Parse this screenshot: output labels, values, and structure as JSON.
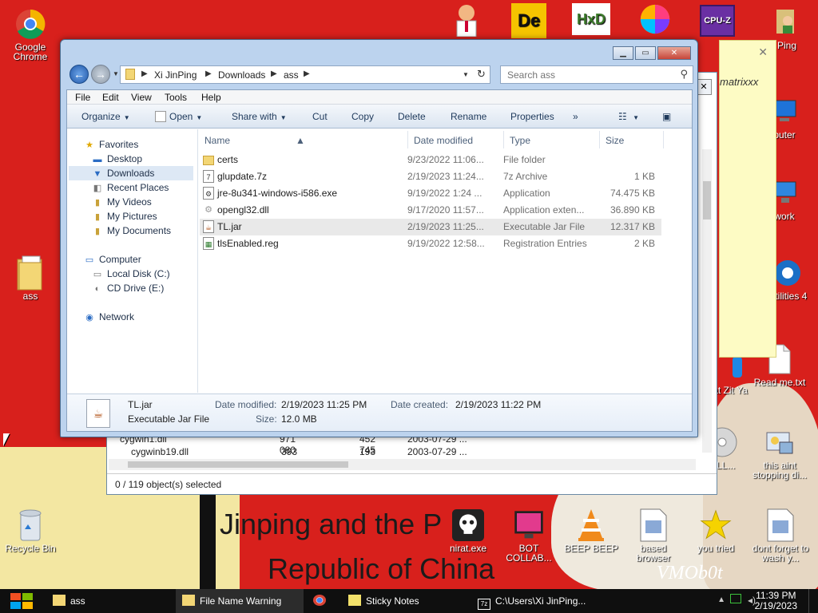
{
  "desktop": {
    "icons": [
      {
        "label": "Google Chrome",
        "icon": "chrome-icon"
      },
      {
        "label": "ass",
        "icon": "folder-icon"
      },
      {
        "label": "Recycle Bin",
        "icon": "recycle-bin-icon"
      },
      {
        "label": "puter",
        "icon": "computer-icon"
      },
      {
        "label": "work",
        "icon": "network-icon"
      },
      {
        "label": "Utilities 4",
        "icon": "utilities-icon"
      },
      {
        "label": "at Zit Ya",
        "icon": "app-icon"
      },
      {
        "label": "Read me.txt",
        "icon": "text-file-icon"
      },
      {
        "label": "this aint stopping di...",
        "icon": "installer-icon"
      },
      {
        "label": "OLL...",
        "icon": "disc-icon"
      },
      {
        "label": "nirat.exe",
        "icon": "skull-icon"
      },
      {
        "label": "BOT COLLAB...",
        "icon": "monitor-icon"
      },
      {
        "label": "BEEP BEEP",
        "icon": "vlc-icon"
      },
      {
        "label": "based browser",
        "icon": "file-icon"
      },
      {
        "label": "you tried",
        "icon": "star-icon"
      },
      {
        "label": "dont forget to wash y...",
        "icon": "file-icon"
      },
      {
        "label": "Ping",
        "icon": "user-icon"
      }
    ],
    "wallpaper_text_line1": "Jinping and the P",
    "wallpaper_text_line2": "Republic of China",
    "wallpaper_signature": "VMOb0t",
    "sticky_note_text": "matrixxx",
    "top_icons": [
      {
        "label": "De",
        "icon": "de-icon"
      },
      {
        "label": "HxD",
        "icon": "hxd-icon"
      },
      {
        "label": "CPU-Z",
        "icon": "cpuz-icon"
      }
    ]
  },
  "bg_window": {
    "rows": [
      {
        "name": "cygwin1.dll",
        "size1": "971 080",
        "size2": "452 745",
        "date": "2003-07-29 ..."
      },
      {
        "name": "cygwinb19.dll",
        "size1": "393 728",
        "size2": "193 160",
        "date": "2003-07-29 ..."
      }
    ],
    "status": "0 / 119 object(s) selected"
  },
  "explorer": {
    "breadcrumb": [
      "Xi JinPing",
      "Downloads",
      "ass"
    ],
    "search_placeholder": "Search ass",
    "menu": [
      "File",
      "Edit",
      "View",
      "Tools",
      "Help"
    ],
    "commands": [
      "Organize",
      "Open",
      "Share with",
      "Cut",
      "Copy",
      "Delete",
      "Rename",
      "Properties"
    ],
    "more_commands": "»",
    "nav": {
      "favorites": "Favorites",
      "favorites_items": [
        "Desktop",
        "Downloads",
        "Recent Places",
        "My Videos",
        "My Pictures",
        "My Documents"
      ],
      "computer": "Computer",
      "computer_items": [
        "Local Disk (C:)",
        "CD Drive (E:)"
      ],
      "network": "Network"
    },
    "columns": [
      "Name",
      "Date modified",
      "Type",
      "Size"
    ],
    "files": [
      {
        "name": "certs",
        "date": "9/23/2022 11:06...",
        "type": "File folder",
        "size": "",
        "icon": "folder-icon"
      },
      {
        "name": "glupdate.7z",
        "date": "2/19/2023 11:24...",
        "type": "7z Archive",
        "size": "1 KB",
        "icon": "archive-icon"
      },
      {
        "name": "jre-8u341-windows-i586.exe",
        "date": "9/19/2022 1:24 ...",
        "type": "Application",
        "size": "74.475 KB",
        "icon": "exe-icon"
      },
      {
        "name": "opengl32.dll",
        "date": "9/17/2020 11:57...",
        "type": "Application exten...",
        "size": "36.890 KB",
        "icon": "dll-icon"
      },
      {
        "name": "TL.jar",
        "date": "2/19/2023 11:25...",
        "type": "Executable Jar File",
        "size": "12.317 KB",
        "icon": "jar-icon"
      },
      {
        "name": "tlsEnabled.reg",
        "date": "9/19/2022 12:58...",
        "type": "Registration Entries",
        "size": "2 KB",
        "icon": "reg-icon"
      }
    ],
    "details": {
      "name": "TL.jar",
      "type": "Executable Jar File",
      "modified_label": "Date modified:",
      "modified": "2/19/2023 11:25 PM",
      "created_label": "Date created:",
      "created": "2/19/2023 11:22 PM",
      "size_label": "Size:",
      "size": "12.0 MB"
    }
  },
  "taskbar": {
    "items": [
      {
        "label": "ass",
        "icon": "folder-icon"
      },
      {
        "label": "File Name Warning",
        "icon": "folder-icon"
      },
      {
        "label": "",
        "icon": "chrome-icon"
      },
      {
        "label": "Sticky Notes",
        "icon": "sticky-notes-icon"
      },
      {
        "label": "C:\\Users\\Xi JinPing...",
        "icon": "7zip-icon"
      }
    ],
    "time": "11:39 PM",
    "date": "2/19/2023"
  }
}
